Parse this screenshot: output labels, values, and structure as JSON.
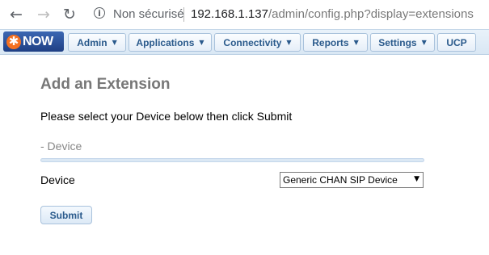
{
  "browser": {
    "back_glyph": "←",
    "forward_glyph": "→",
    "reload_glyph": "↻",
    "info_glyph": "i",
    "security_text": "Non sécurisé",
    "url_host": "192.168.1.137",
    "url_path": "/admin/config.php?display=extensions"
  },
  "logo": {
    "text": "NOW",
    "star": "✱",
    "brand_color": "#f37021"
  },
  "menu": {
    "items": [
      {
        "label": "Admin",
        "has_caret": true
      },
      {
        "label": "Applications",
        "has_caret": true
      },
      {
        "label": "Connectivity",
        "has_caret": true
      },
      {
        "label": "Reports",
        "has_caret": true
      },
      {
        "label": "Settings",
        "has_caret": true
      },
      {
        "label": "UCP",
        "has_caret": false
      }
    ],
    "caret_glyph": "▼"
  },
  "content": {
    "title": "Add an Extension",
    "instructions": "Please select your Device below then click Submit",
    "section_header": "- Device",
    "device_label": "Device",
    "device_select_value": "Generic CHAN SIP Device",
    "select_arrow": "▼",
    "submit_label": "Submit"
  }
}
